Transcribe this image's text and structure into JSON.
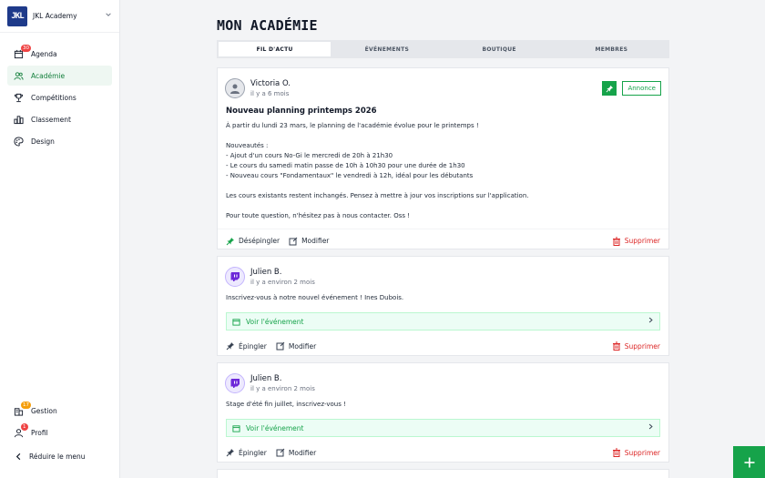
{
  "sidebar": {
    "brand": {
      "logo_text": "JKL",
      "name": "JKL Academy"
    },
    "items": [
      {
        "label": "Agenda",
        "icon": "calendar-icon",
        "badge": "30"
      },
      {
        "label": "Académie",
        "icon": "users-icon",
        "active": true
      },
      {
        "label": "Compétitions",
        "icon": "trophy-icon"
      },
      {
        "label": "Classement",
        "icon": "ranking-icon"
      },
      {
        "label": "Design",
        "icon": "palette-icon"
      }
    ],
    "bottom": [
      {
        "label": "Gestion",
        "icon": "building-icon",
        "badge": "17"
      },
      {
        "label": "Profil",
        "icon": "user-icon",
        "badge": "1"
      }
    ],
    "reduce_label": "Réduire le menu"
  },
  "page": {
    "title": "MON ACADÉMIE",
    "tabs": [
      "FIL D'ACTU",
      "ÉVÉNEMENTS",
      "BOUTIQUE",
      "MEMBRES"
    ],
    "active_tab": 0
  },
  "posts": [
    {
      "author": "Victoria O.",
      "time": "il y a 6 mois",
      "tag": "Annonce",
      "title": "Nouveau planning printemps 2026",
      "paragraphs": [
        "À partir du lundi 23 mars, le planning de l'académie évolue pour le printemps !",
        "Nouveautés :",
        "- Ajout d'un cours No-Gi le mercredi de 20h à 21h30",
        "- Le cours du samedi matin passe de 10h à 10h30 pour une durée de 1h30",
        "- Nouveau cours \"Fondamentaux\" le vendredi à 12h, idéal pour les débutants",
        "Les cours existants restent inchangés. Pensez à mettre à jour vos inscriptions sur l'application.",
        "Pour toute question, n'hésitez pas à nous contacter. Oss !"
      ],
      "pin_action": "Désépingler",
      "edit_action": "Modifier",
      "delete_action": "Supprimer"
    },
    {
      "author": "Julien B.",
      "time": "il y a environ 2 mois",
      "text": "Inscrivez-vous à notre nouvel événement ! Ines Dubois.",
      "event_link": "Voir l'événement",
      "pin_action": "Épingler",
      "edit_action": "Modifier",
      "delete_action": "Supprimer"
    },
    {
      "author": "Julien B.",
      "time": "il y a environ 2 mois",
      "text": "Stage d'été fin juillet, inscrivez-vous !",
      "event_link": "Voir l'événement",
      "pin_action": "Épingler",
      "edit_action": "Modifier",
      "delete_action": "Supprimer"
    }
  ],
  "fab": {
    "icon": "plus-icon"
  },
  "colors": {
    "accent": "#16a34a",
    "danger": "#dc2626",
    "badge": "#ef4444",
    "brand": "#1e3a8a"
  }
}
